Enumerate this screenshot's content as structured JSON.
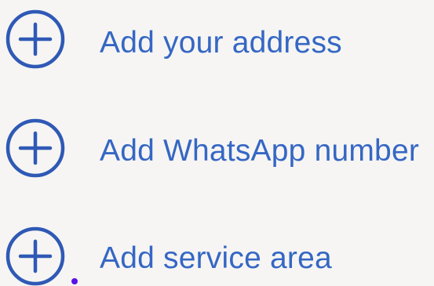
{
  "colors": {
    "background": "#f6f5f3",
    "accent": "#2f59b5",
    "label": "#3567c4",
    "cursor": "#5a12e8"
  },
  "actions": [
    {
      "label": "Add your address",
      "icon": "plus-circle-icon"
    },
    {
      "label": "Add WhatsApp number",
      "icon": "plus-circle-icon"
    },
    {
      "label": "Add service area",
      "icon": "plus-circle-icon"
    }
  ]
}
